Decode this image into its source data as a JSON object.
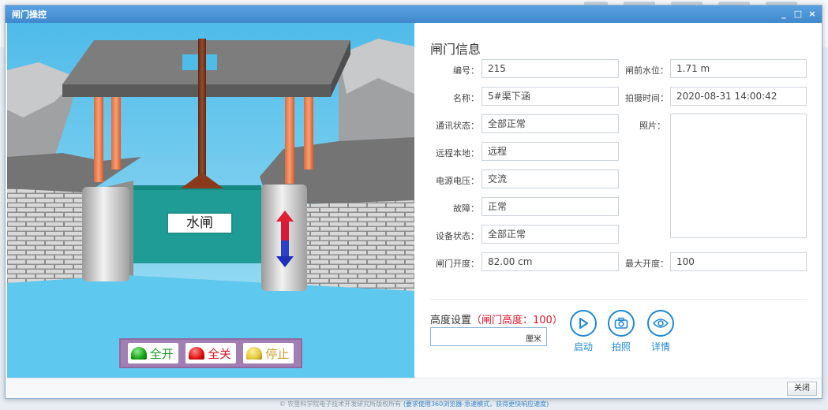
{
  "window": {
    "title": "闸门操控",
    "minimize": "_",
    "maximize": "□",
    "close": "×"
  },
  "scene": {
    "gate_label": "水闸",
    "buttons": {
      "open_all": "全开",
      "close_all": "全关",
      "stop": "停止"
    }
  },
  "info": {
    "title": "闸门信息",
    "fields": {
      "id": {
        "label": "编号：",
        "value": "215"
      },
      "water_level": {
        "label": "闸前水位：",
        "value": "1.71 m"
      },
      "name": {
        "label": "名称：",
        "value": "5#渠下涵"
      },
      "capture_time": {
        "label": "拍摄时间：",
        "value": "2020-08-31 14:00:42"
      },
      "comm_status": {
        "label": "通讯状态：",
        "value": "全部正常"
      },
      "photo": {
        "label": "照片："
      },
      "remote_local": {
        "label": "远程本地：",
        "value": "远程"
      },
      "power_voltage": {
        "label": "电源电压：",
        "value": "交流"
      },
      "fault": {
        "label": "故障：",
        "value": "正常"
      },
      "device_status": {
        "label": "设备状态：",
        "value": "全部正常"
      },
      "gate_opening": {
        "label": "闸门开度：",
        "value": "82.00 cm"
      },
      "max_opening": {
        "label": "最大开度：",
        "value": "100"
      }
    }
  },
  "height_setting": {
    "label": "高度设置",
    "hint": "（闸门高度：100）",
    "unit": "厘米",
    "value": ""
  },
  "actions": {
    "start": "启动",
    "photo": "拍照",
    "detail": "详情"
  },
  "footer": {
    "close": "关闭"
  },
  "copyright": {
    "text": "© 农垦科学院电子技术开发研究所版权所有",
    "note": "(要求使用360浏览器-急速模式，获得更快响应速度)"
  },
  "colors": {
    "accent": "#1e88d6",
    "hint_red": "#e0162b",
    "titlebar": "#4a95d6",
    "water": "#5ec8ee"
  }
}
